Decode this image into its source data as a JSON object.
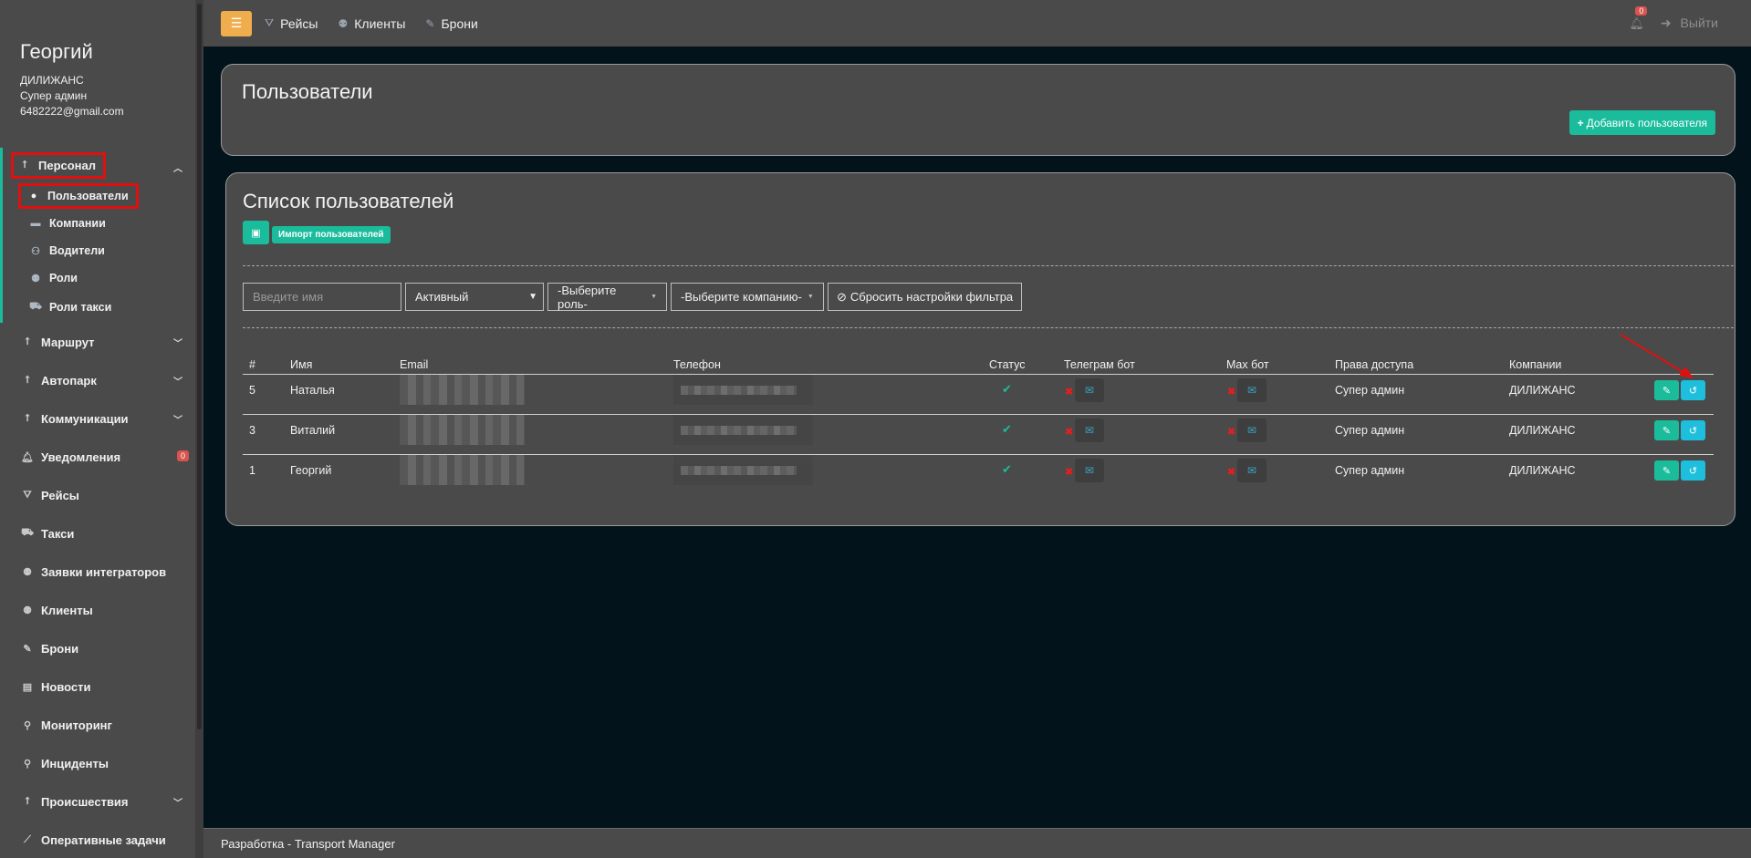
{
  "profile": {
    "name": "Георгий",
    "company": "ДИЛИЖАНС",
    "role": "Супер админ",
    "email": "6482222@gmail.com"
  },
  "sidebar": {
    "personnel": {
      "label": "Персонал",
      "items": [
        "Пользователи",
        "Компании",
        "Водители",
        "Роли",
        "Роли такси"
      ]
    },
    "items": [
      {
        "label": "Маршрут",
        "chevron": true
      },
      {
        "label": "Автопарк",
        "chevron": true
      },
      {
        "label": "Коммуникации",
        "chevron": true
      },
      {
        "label": "Уведомления",
        "badge": "0"
      },
      {
        "label": "Рейсы"
      },
      {
        "label": "Такси"
      },
      {
        "label": "Заявки интеграторов"
      },
      {
        "label": "Клиенты"
      },
      {
        "label": "Брони"
      },
      {
        "label": "Новости"
      },
      {
        "label": "Мониторинг"
      },
      {
        "label": "Инциденты"
      },
      {
        "label": "Происшествия",
        "chevron": true
      },
      {
        "label": "Оперативные задачи"
      }
    ]
  },
  "topbar": {
    "nav": [
      "Рейсы",
      "Клиенты",
      "Брони"
    ],
    "notifications_count": "0",
    "logout": "Выйти"
  },
  "users_panel": {
    "title": "Пользователи",
    "add_button": "Добавить пользователя"
  },
  "list_panel": {
    "title": "Список пользователей",
    "import_button": "Импорт пользователей",
    "filters": {
      "name_placeholder": "Введите имя",
      "status": "Активный",
      "role": "-Выберите роль-",
      "company": "-Выберите компанию-",
      "reset": "Сбросить настройки фильтра"
    },
    "columns": [
      "#",
      "Имя",
      "Email",
      "Телефон",
      "Статус",
      "Телеграм бот",
      "Max бот",
      "Права доступа",
      "Компании"
    ],
    "rows": [
      {
        "id": "5",
        "name": "Наталья",
        "access": "Супер админ",
        "company": "ДИЛИЖАНС"
      },
      {
        "id": "3",
        "name": "Виталий",
        "access": "Супер админ",
        "company": "ДИЛИЖАНС"
      },
      {
        "id": "1",
        "name": "Георгий",
        "access": "Супер админ",
        "company": "ДИЛИЖАНС"
      }
    ]
  },
  "footer": {
    "text": "Разработка - Transport Manager"
  },
  "colors": {
    "accent": "#1abc9c",
    "info": "#1ebedd",
    "warning": "#f0ad4e",
    "danger": "#d9534f",
    "annotation": "#e01010"
  }
}
